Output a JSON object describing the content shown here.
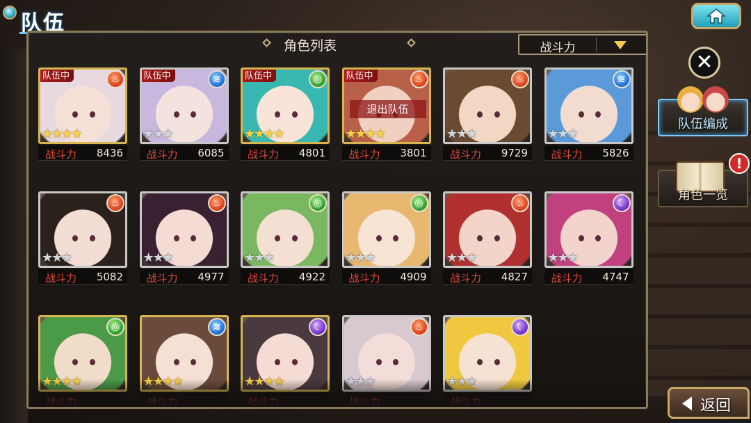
{
  "header": {
    "title": "队伍"
  },
  "panel": {
    "title": "角色列表",
    "sort_label": "战斗力"
  },
  "side": {
    "team_edit_label": "队伍编成",
    "char_list_label": "角色一览",
    "alert": "!"
  },
  "back_label": "返回",
  "power_label": "战斗力",
  "leave_label": "退出队伍",
  "characters": [
    {
      "power": "8436",
      "tag": "队伍中",
      "element": "fire",
      "stars": "★★★★",
      "star_color": "gold",
      "frame": "gold",
      "hair": "#e8d8e0",
      "skin": "#f6dfd6"
    },
    {
      "power": "6085",
      "tag": "队伍中",
      "element": "water",
      "stars": "★★★",
      "star_color": "silver",
      "frame": "silver",
      "hair": "#c8b8e0",
      "skin": "#f4e2de"
    },
    {
      "power": "4801",
      "tag": "队伍中",
      "element": "wind",
      "stars": "★★★★",
      "star_color": "gold",
      "frame": "gold",
      "hair": "#38b8b0",
      "skin": "#f8e4d8"
    },
    {
      "power": "3801",
      "tag": "队伍中",
      "element": "fire",
      "stars": "★★★★",
      "star_color": "gold",
      "frame": "gold",
      "hair": "#b86048",
      "skin": "#f0d0c0",
      "leave": true
    },
    {
      "power": "9729",
      "tag": "",
      "element": "fire",
      "stars": "★★★",
      "star_color": "silver",
      "frame": "silver",
      "hair": "#6a4a30",
      "skin": "#f2d8c4"
    },
    {
      "power": "5826",
      "tag": "",
      "element": "water",
      "stars": "★★★",
      "star_color": "silver",
      "frame": "silver",
      "hair": "#5a9ad8",
      "skin": "#f2dcd0"
    },
    {
      "power": "5082",
      "tag": "",
      "element": "fire",
      "stars": "★★★",
      "star_color": "silver",
      "frame": "silver",
      "hair": "#2a201c",
      "skin": "#f2dcd4"
    },
    {
      "power": "4977",
      "tag": "",
      "element": "fire",
      "stars": "★★★",
      "star_color": "silver",
      "frame": "silver",
      "hair": "#3a2030",
      "skin": "#f4dcd4"
    },
    {
      "power": "4922",
      "tag": "",
      "element": "wind",
      "stars": "★★★",
      "star_color": "silver",
      "frame": "silver",
      "hair": "#7ab860",
      "skin": "#f4e0d2"
    },
    {
      "power": "4909",
      "tag": "",
      "element": "wind",
      "stars": "★★★",
      "star_color": "silver",
      "frame": "silver",
      "hair": "#e8b870",
      "skin": "#f8e4d4"
    },
    {
      "power": "4827",
      "tag": "",
      "element": "fire",
      "stars": "★★★",
      "star_color": "silver",
      "frame": "silver",
      "hair": "#b03030",
      "skin": "#f2d4c8"
    },
    {
      "power": "4747",
      "tag": "",
      "element": "dark",
      "stars": "★★★",
      "star_color": "silver",
      "frame": "silver",
      "hair": "#c04080",
      "skin": "#f2d4cc"
    },
    {
      "power": "",
      "tag": "",
      "element": "wind",
      "stars": "★★★★",
      "star_color": "gold",
      "frame": "gold",
      "hair": "#4a9a48",
      "skin": "#f0dcc8"
    },
    {
      "power": "",
      "tag": "",
      "element": "water",
      "stars": "★★★★",
      "star_color": "gold",
      "frame": "gold",
      "hair": "#6a4a3a",
      "skin": "#f6e0d4"
    },
    {
      "power": "",
      "tag": "",
      "element": "dark",
      "stars": "★★★★",
      "star_color": "gold",
      "frame": "gold",
      "hair": "#4a3a40",
      "skin": "#f4dcd4"
    },
    {
      "power": "",
      "tag": "",
      "element": "fire",
      "stars": "★★★",
      "star_color": "silver",
      "frame": "silver",
      "hair": "#d8c8d0",
      "skin": "#f4dcd8"
    },
    {
      "power": "",
      "tag": "",
      "element": "dark",
      "stars": "★★★",
      "star_color": "silver",
      "frame": "silver",
      "hair": "#f0c840",
      "skin": "#f6e2d2"
    }
  ],
  "element_glyphs": {
    "fire": "♨",
    "water": "≋",
    "wind": "◎",
    "dark": "☾"
  }
}
